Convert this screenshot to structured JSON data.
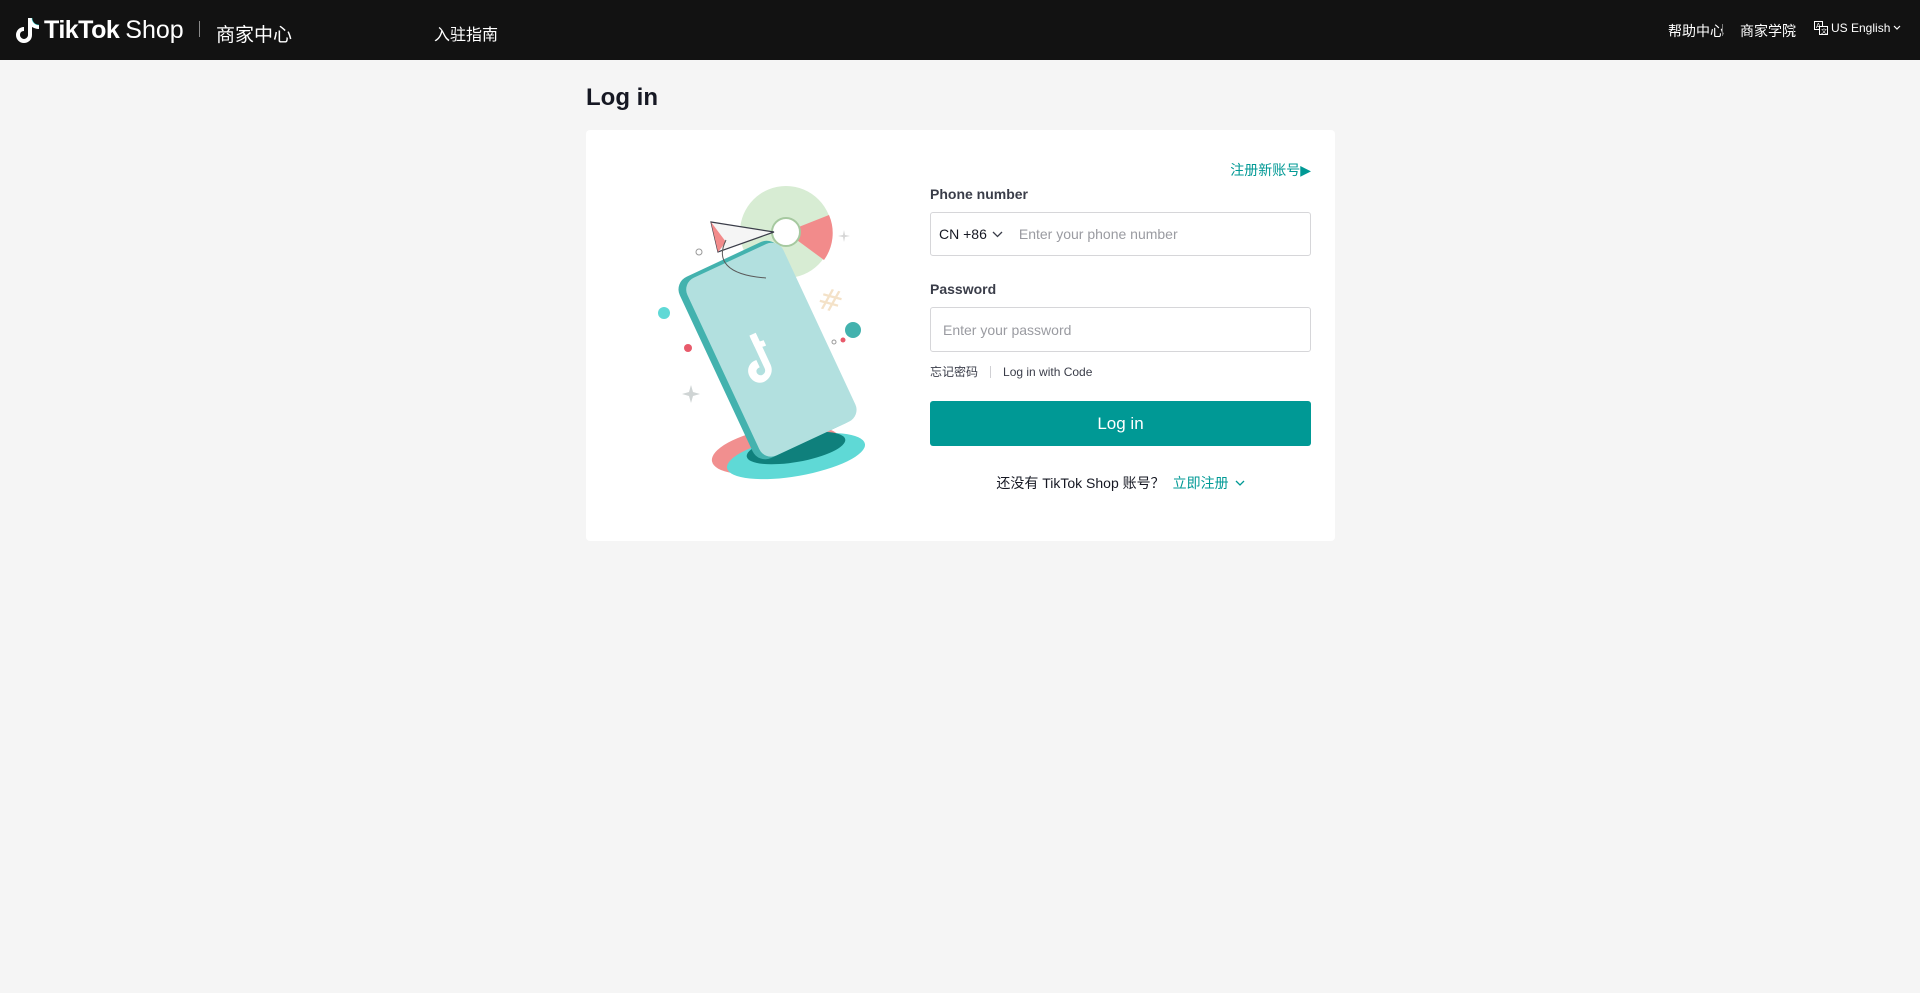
{
  "header": {
    "brand_name": "TikTok",
    "brand_shop": "Shop",
    "brand_sub": "商家中心",
    "nav_link": "入驻指南",
    "right_links": [
      "帮助中心",
      "商家学院"
    ],
    "language": "US English"
  },
  "page": {
    "title": "Log in"
  },
  "card": {
    "top_link": "注册新账号▶",
    "phone_label": "Phone number",
    "country_code": "CN +86",
    "phone_placeholder": "Enter your phone number",
    "password_label": "Password",
    "password_placeholder": "Enter your password",
    "forgot_password": "忘记密码",
    "login_with_code": "Log in with Code",
    "login_button": "Log in",
    "footer_text": "还没有 TikTok Shop 账号？",
    "footer_link": "立即注册"
  },
  "colors": {
    "accent": "#009995",
    "topbar": "#121212",
    "background": "#f5f5f5"
  }
}
